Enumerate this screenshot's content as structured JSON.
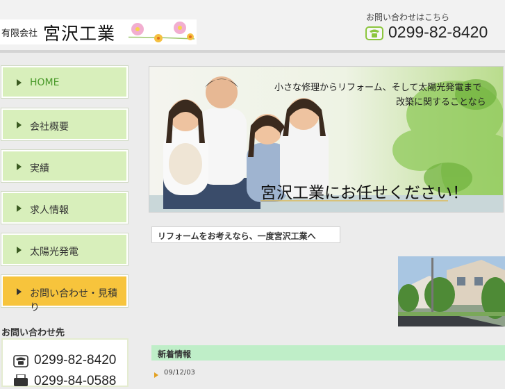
{
  "header": {
    "logo_small": "有限会社",
    "logo_name": "宮沢工業",
    "contact_label": "お問い合わせはこちら",
    "phone": "0299-82-8420"
  },
  "nav": {
    "items": [
      {
        "label": "HOME"
      },
      {
        "label": "会社概要"
      },
      {
        "label": "実績"
      },
      {
        "label": "求人情報"
      },
      {
        "label": "太陽光発電"
      },
      {
        "label": "お問い合わせ・見積り"
      }
    ]
  },
  "side_contact": {
    "title": "お問い合わせ先",
    "phone": "0299-82-8420",
    "fax": "0299-84-0588"
  },
  "hero": {
    "line1": "小さな修理からリフォーム、そして太陽光発電まで",
    "line2": "改築に関することなら",
    "banner": "宮沢工業にお任せください！"
  },
  "section": {
    "heading": "リフォームをお考えなら、一度宮沢工業へ"
  },
  "news": {
    "title": "新着情報",
    "date": "09/12/03"
  },
  "colors": {
    "nav_bg": "#d8efbb",
    "nav_highlight": "#f7c43c",
    "news_bar": "#bfeec8",
    "accent_green": "#4a9a2a"
  }
}
